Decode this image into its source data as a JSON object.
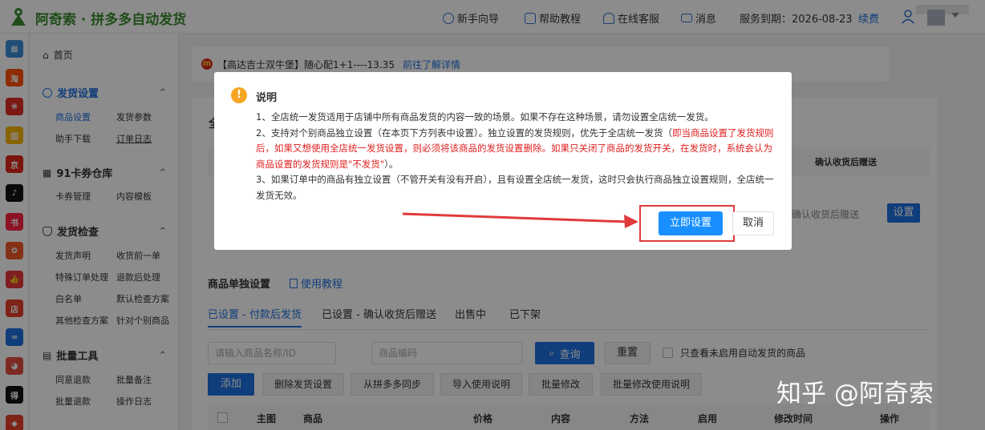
{
  "topbar": {
    "app_title": "阿奇索 · 拼多多自动发货",
    "items": [
      {
        "label": "新手向导",
        "icon": "help-circle-icon"
      },
      {
        "label": "帮助教程",
        "icon": "document-icon"
      },
      {
        "label": "在线客服",
        "icon": "headset-icon"
      },
      {
        "label": "消息",
        "icon": "mail-icon"
      }
    ],
    "service_expiry": "服务到期：2026-08-23",
    "renew": "续费"
  },
  "platforms": [
    {
      "name": "grid-icon",
      "color": "#3b8fd9",
      "text": "▦"
    },
    {
      "name": "taobao-icon",
      "color": "#ff5000",
      "text": "淘"
    },
    {
      "name": "pinduoduo-icon",
      "color": "#e02e24",
      "text": "❀"
    },
    {
      "name": "kuaishou-icon",
      "color": "#f7b500",
      "text": "固"
    },
    {
      "name": "jd-icon",
      "color": "#e1251b",
      "text": "京"
    },
    {
      "name": "douyin-icon",
      "color": "#111111",
      "text": "♪"
    },
    {
      "name": "xiaohongshu-icon",
      "color": "#ff2442",
      "text": "书"
    },
    {
      "name": "weidian-icon",
      "color": "#f05a28",
      "text": "✿"
    },
    {
      "name": "thumb-icon",
      "color": "#e83a3a",
      "text": "👍"
    },
    {
      "name": "shop-icon",
      "color": "#e8402a",
      "text": "店"
    },
    {
      "name": "link-icon",
      "color": "#1e6fe0",
      "text": "∞"
    },
    {
      "name": "youzan-icon",
      "color": "#e54d42",
      "text": "◕"
    },
    {
      "name": "dewu-icon",
      "color": "#111111",
      "text": "得"
    },
    {
      "name": "other-icon",
      "color": "#e8402a",
      "text": "◆"
    }
  ],
  "sidebar": {
    "home": "首页",
    "sections": [
      {
        "title": "发货设置",
        "items": [
          "商品设置",
          "发货参数",
          "助手下载",
          "订单日志"
        ]
      },
      {
        "title": "91卡券仓库",
        "items": [
          "卡券管理",
          "内容模板"
        ]
      },
      {
        "title": "发货检查",
        "items": [
          "发货声明",
          "收货前一单",
          "特殊订单处理",
          "退款后处理",
          "白名单",
          "默认检查方案",
          "其他检查方案",
          "针对个别商品"
        ]
      },
      {
        "title": "批量工具",
        "items": [
          "同意退款",
          "批量备注",
          "批量退款",
          "操作日志"
        ]
      }
    ]
  },
  "notice": {
    "text": "【高达吉士双牛堡】随心配1+1----13.35",
    "link": "前往了解详情"
  },
  "main": {
    "card_title_partial": "全",
    "header_cell": "确认收货后赠送",
    "row_text": "确认收货后赠送",
    "row_button": "设置",
    "section2_title": "商品单独设置",
    "section2_link": "使用教程",
    "tabs": [
      "已设置 - 付款后发货",
      "已设置 - 确认收货后赠送",
      "出售中",
      "已下架"
    ],
    "search_placeholder": "请输入商品名称/ID",
    "code_placeholder": "商品编码",
    "query_button": "查询",
    "reset_button": "重置",
    "checkbox_label": "只查看未启用自动发货的商品",
    "add_button": "添加",
    "action_buttons": [
      "删除发货设置",
      "从拼多多同步",
      "导入使用说明",
      "批量修改",
      "批量修改使用说明"
    ],
    "table_headers": [
      "主图",
      "商品",
      "价格",
      "内容",
      "方法",
      "启用",
      "修改时间",
      "操作"
    ]
  },
  "modal": {
    "title": "说明",
    "p1": "1、全店统一发货适用于店铺中所有商品发货的内容一致的场景。如果不存在这种场景，请勿设置全店统一发货。",
    "p2_normal_a": "2、支持对个别商品独立设置（在本页下方列表中设置）。独立设置的发货规则，优先于全店统一发货（",
    "p2_red": "即当商品设置了发货规则后，如果又想使用全店统一发货设置，则必须将该商品的发货设置删除。如果只关闭了商品的发货开关，在发货时，系统会认为商品设置的发货规则是\"不发货\"",
    "p2_normal_b": "）。",
    "p3": "3、如果订单中的商品有独立设置（不管开关有没有开启），且有设置全店统一发货，这时只会执行商品独立设置规则，全店统一发货无效。",
    "confirm_button": "立即设置",
    "cancel_button": "取消"
  },
  "watermark": "知乎 @阿奇索"
}
